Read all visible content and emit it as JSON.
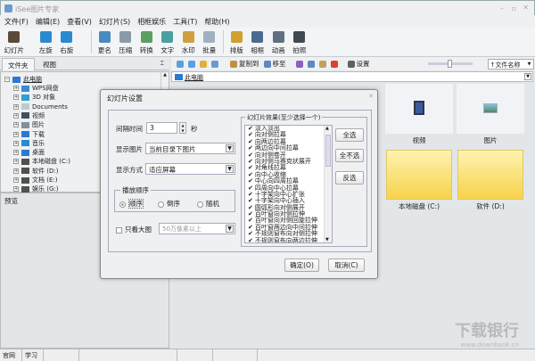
{
  "window": {
    "title": "iSee图片专家"
  },
  "menu": [
    "文件(F)",
    "编辑(E)",
    "查看(V)",
    "幻灯片(S)",
    "相框娱乐",
    "工具(T)",
    "帮助(H)"
  ],
  "toolbar": [
    {
      "label": "幻灯片",
      "icon": "slideshow-icon",
      "color": "#5a4a3a"
    },
    {
      "label": "左旋",
      "icon": "rotate-left-icon",
      "color": "#2a8ad0"
    },
    {
      "label": "右旋",
      "icon": "rotate-right-icon",
      "color": "#2a8ad0"
    },
    {
      "label": "更名",
      "icon": "rename-icon",
      "color": "#4a8ac0"
    },
    {
      "label": "压缩",
      "icon": "compress-icon",
      "color": "#8a9aa8"
    },
    {
      "label": "转换",
      "icon": "convert-icon",
      "color": "#5aa060"
    },
    {
      "label": "文字",
      "icon": "text-icon",
      "color": "#4aa0a0"
    },
    {
      "label": "水印",
      "icon": "watermark-icon",
      "color": "#d0a040"
    },
    {
      "label": "批量",
      "icon": "batch-icon",
      "color": "#a0b0c0"
    },
    {
      "label": "排版",
      "icon": "layout-icon",
      "color": "#d0a030"
    },
    {
      "label": "相框",
      "icon": "frame-icon",
      "color": "#4a6a90"
    },
    {
      "label": "动画",
      "icon": "animation-icon",
      "color": "#607080"
    },
    {
      "label": "拍照",
      "icon": "camera-icon",
      "color": "#404850"
    }
  ],
  "left_tabs": [
    "文件夹",
    "视图"
  ],
  "tree": {
    "root": "此电脑",
    "items": [
      {
        "label": "WPS网盘",
        "icon": "cloud-icon",
        "color": "#3a8ad8"
      },
      {
        "label": "3D 对象",
        "icon": "cube-icon",
        "color": "#30a0d0"
      },
      {
        "label": "Documents",
        "icon": "document-icon",
        "color": "#c0c8d0"
      },
      {
        "label": "视频",
        "icon": "video-icon",
        "color": "#405060"
      },
      {
        "label": "图片",
        "icon": "picture-icon",
        "color": "#8090a0"
      },
      {
        "label": "下载",
        "icon": "download-icon",
        "color": "#2a7ad0"
      },
      {
        "label": "音乐",
        "icon": "music-icon",
        "color": "#2a8ad0"
      },
      {
        "label": "桌面",
        "icon": "desktop-icon",
        "color": "#2a7ad0"
      },
      {
        "label": "本地磁盘 (C:)",
        "icon": "drive-icon",
        "color": "#505050"
      },
      {
        "label": "软件 (D:)",
        "icon": "drive-icon",
        "color": "#505050"
      },
      {
        "label": "文档 (E:)",
        "icon": "drive-icon",
        "color": "#505050"
      },
      {
        "label": "娱乐 (G:)",
        "icon": "drive-icon",
        "color": "#505050"
      }
    ]
  },
  "preview_label": "预览",
  "navbar": {
    "copy_to": "复制到",
    "move_to": "移至",
    "settings": "设置",
    "sort": "↑文件名称",
    "zoom_slider": 0.5
  },
  "address": "此电脑",
  "content": {
    "items": [
      "视频",
      "图片",
      "本地磁盘 (C:)",
      "软件 (D:)"
    ]
  },
  "status": [
    "官网",
    "学习"
  ],
  "dialog": {
    "title": "幻灯片设置",
    "interval_label": "间隔时间",
    "interval_value": "3",
    "interval_unit": "秒",
    "show_pictures_label": "显示图片",
    "show_pictures_value": "当前目录下图片",
    "display_mode_label": "显示方式",
    "display_mode_value": "适应屏幕",
    "order_group": "播放顺序",
    "order_options": [
      "顺序",
      "倒序",
      "随机"
    ],
    "order_selected": "顺序",
    "large_only_label": "只看大图",
    "large_only_checked": false,
    "large_only_value": "50万像素以上",
    "effects_group": "幻灯片效果(至少选择一个)",
    "effects": [
      "淡入淡出",
      "向对侧拉幕",
      "向两边拉幕",
      "两边向中间拉幕",
      "向对侧卷开",
      "向对侧马赛克状展开",
      "对角线拉幕",
      "向中心收缩",
      "中心向四周拉幕",
      "四周向中心拉幕",
      "十字架向中心扩张",
      "十字架向中心插入",
      "圆弧形向对侧展开",
      "百叶窗向对侧拉伸",
      "百叶窗向对侧回旋拉伸",
      "百叶窗两边向中间拉伸",
      "不规则窗布向对侧拉伸",
      "不规则窗布向两边拉伸"
    ],
    "select_all": "全选",
    "select_none": "全不选",
    "invert": "反选",
    "ok": "确定(O)",
    "cancel": "取消(C)"
  },
  "watermark": {
    "text": "下载银行",
    "url": "www.downbank.cn"
  }
}
